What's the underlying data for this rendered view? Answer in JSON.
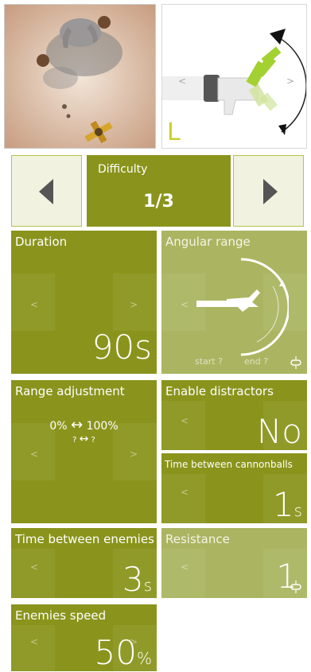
{
  "difficulty": {
    "label": "Difficulty",
    "value": "1/3"
  },
  "hand_preview": {
    "side_letter": "L"
  },
  "tiles": {
    "duration": {
      "title": "Duration",
      "value": "90s"
    },
    "angular_range": {
      "title": "Angular range",
      "start_label": "start ?",
      "end_label": "end ?"
    },
    "range_adjustment": {
      "title": "Range adjustment",
      "from": "0%",
      "to": "100%",
      "from_small": "?",
      "to_small": "?"
    },
    "enable_distractors": {
      "title": "Enable distractors",
      "value": "No"
    },
    "time_between_cannonballs": {
      "title": "Time between cannonballs",
      "value": "1",
      "unit": "s"
    },
    "time_between_enemies": {
      "title": "Time between enemies",
      "value": "3",
      "unit": "s"
    },
    "resistance": {
      "title": "Resistance",
      "value": "1"
    },
    "enemies_speed": {
      "title": "Enemies speed",
      "value": "50",
      "unit": "%"
    }
  },
  "colors": {
    "tile": "#8a941c",
    "tile_dim": "#abb561",
    "nav_bg": "#f1f2e0",
    "accent": "#a8d13a"
  },
  "icons": {
    "prev": "triangle-left-icon",
    "next": "triangle-right-icon",
    "link": "link-broken-icon"
  }
}
